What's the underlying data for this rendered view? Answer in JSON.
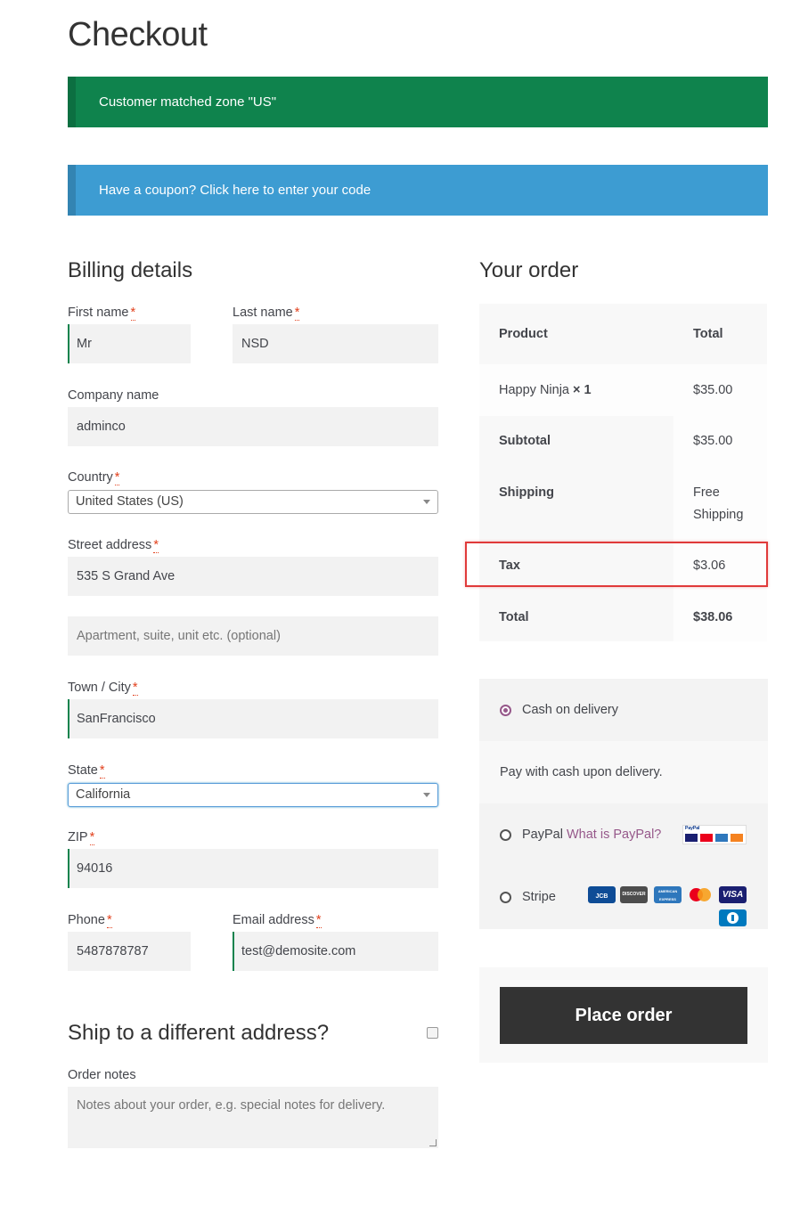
{
  "page": {
    "title": "Checkout"
  },
  "notices": {
    "zone": "Customer matched zone \"US\"",
    "coupon": "Have a coupon? Click here to enter your code"
  },
  "billing": {
    "title": "Billing details",
    "required_mark": "*",
    "first_name": {
      "label": "First name",
      "value": "Mr"
    },
    "last_name": {
      "label": "Last name",
      "value": "NSD"
    },
    "company": {
      "label": "Company name",
      "value": "adminco"
    },
    "country": {
      "label": "Country",
      "value": "United States (US)"
    },
    "street": {
      "label": "Street address",
      "value": "535 S Grand Ave",
      "placeholder2": "Apartment, suite, unit etc. (optional)"
    },
    "city": {
      "label": "Town / City",
      "value": "SanFrancisco"
    },
    "state": {
      "label": "State",
      "value": "California"
    },
    "zip": {
      "label": "ZIP",
      "value": "94016"
    },
    "phone": {
      "label": "Phone",
      "value": "5487878787"
    },
    "email": {
      "label": "Email address",
      "value": "test@demosite.com"
    }
  },
  "shipping": {
    "title": "Ship to a different address?"
  },
  "notes": {
    "label": "Order notes",
    "placeholder": "Notes about your order, e.g. special notes for delivery."
  },
  "order": {
    "title": "Your order",
    "head": {
      "product": "Product",
      "total": "Total"
    },
    "item": {
      "name": "Happy Ninja",
      "qty": "× 1",
      "total": "$35.00"
    },
    "subtotal": {
      "label": "Subtotal",
      "value": "$35.00"
    },
    "shipping": {
      "label": "Shipping",
      "line1": "Free",
      "line2": "Shipping"
    },
    "tax": {
      "label": "Tax",
      "value": "$3.06"
    },
    "total": {
      "label": "Total",
      "value": "$38.06"
    }
  },
  "payment": {
    "cod": {
      "label": "Cash on delivery",
      "description": "Pay with cash upon delivery."
    },
    "paypal": {
      "label": "PayPal",
      "link": "What is PayPal?",
      "badge": "PayPal"
    },
    "stripe": {
      "label": "Stripe"
    },
    "cards": {
      "jcb": "JCB",
      "discover": "DISCOVER",
      "amex": "AMERICAN EXPRESS",
      "visa": "VISA"
    },
    "accent_color": "#96588a"
  },
  "place_order": {
    "label": "Place order"
  },
  "colors": {
    "success": "#0f834d",
    "info": "#3d9cd2",
    "highlight": "#e03a3a",
    "button": "#333333"
  }
}
